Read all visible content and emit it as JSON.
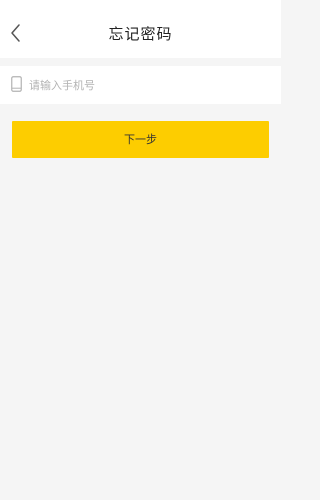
{
  "header": {
    "title": "忘记密码",
    "back_icon": "chevron-left-icon"
  },
  "form": {
    "phone_icon": "mobile-phone-icon",
    "phone_placeholder": "请输入手机号",
    "phone_value": ""
  },
  "actions": {
    "next_label": "下一步"
  },
  "colors": {
    "accent": "#fdcd00",
    "background": "#f5f5f5",
    "surface": "#ffffff",
    "text": "#222222",
    "placeholder": "#b3b3b3"
  }
}
